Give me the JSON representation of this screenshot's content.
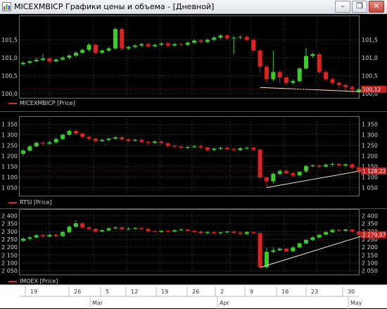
{
  "window": {
    "title": "MICEXMBICP Графики цены и объема - [Дневной]",
    "buttons": {
      "minimize": "–",
      "restore": "❐",
      "close": "✕"
    }
  },
  "colors": {
    "up": "#3ccd2d",
    "down": "#e32020",
    "grid": "#4a4a4a",
    "trend": "#f0e6c8",
    "price_label": "#c81e1e",
    "legend_line": "#d03030"
  },
  "panels": [
    {
      "id": "micex",
      "legend": "MICEXMBICP [Price]",
      "y_ticks": [
        "101,5",
        "101,0",
        "100,5",
        "100,0"
      ],
      "last_price": "100,12"
    },
    {
      "id": "rtsi",
      "legend": "RTSI [Price]",
      "y_ticks": [
        "1 350",
        "1 300",
        "1 250",
        "1 200",
        "1 150",
        "1 100",
        "1 050"
      ],
      "last_price": "1 128,22"
    },
    {
      "id": "imoex",
      "legend": "IMOEX [Price]",
      "y_ticks": [
        "2 400",
        "2 350",
        "2 300",
        "2 250",
        "2 200",
        "2 150",
        "2 100",
        "2 050"
      ],
      "last_price": "2 279,07"
    }
  ],
  "x_axis": {
    "days": [
      "19",
      "26",
      "5",
      "12",
      "19",
      "26",
      "2",
      "9",
      "16",
      "23",
      "30"
    ],
    "months": [
      "Mar",
      "Apr",
      "May"
    ]
  },
  "chart_data": [
    {
      "type": "candlestick",
      "series": "MICEXMBICP [Price]",
      "ylim": [
        99.9,
        102.1
      ],
      "last": 100.12,
      "candles": [
        [
          100.82,
          100.86,
          100.78,
          100.9
        ],
        [
          100.86,
          100.9,
          100.83,
          100.93
        ],
        [
          100.9,
          100.94,
          100.87,
          101.0
        ],
        [
          100.94,
          100.98,
          100.9,
          101.1
        ],
        [
          100.98,
          100.9,
          100.86,
          101.02
        ],
        [
          100.9,
          100.95,
          100.87,
          100.98
        ],
        [
          100.95,
          101.0,
          100.92,
          101.05
        ],
        [
          101.0,
          101.06,
          100.96,
          101.09
        ],
        [
          101.06,
          101.14,
          101.02,
          101.18
        ],
        [
          101.14,
          101.22,
          101.1,
          101.26
        ],
        [
          101.22,
          101.36,
          101.18,
          101.4
        ],
        [
          101.36,
          101.14,
          101.1,
          101.4
        ],
        [
          101.14,
          101.2,
          101.1,
          101.24
        ],
        [
          101.2,
          101.26,
          101.16,
          101.3
        ],
        [
          101.26,
          101.8,
          101.22,
          101.84
        ],
        [
          101.8,
          101.26,
          101.2,
          101.84
        ],
        [
          101.26,
          101.3,
          101.22,
          101.34
        ],
        [
          101.3,
          101.34,
          101.26,
          101.38
        ],
        [
          101.34,
          101.38,
          101.3,
          101.42
        ],
        [
          101.38,
          101.32,
          101.28,
          101.42
        ],
        [
          101.32,
          101.36,
          101.28,
          101.4
        ],
        [
          101.36,
          101.4,
          101.32,
          101.44
        ],
        [
          101.4,
          101.34,
          101.3,
          101.44
        ],
        [
          101.34,
          101.38,
          101.3,
          101.42
        ],
        [
          101.38,
          101.36,
          101.32,
          101.42
        ],
        [
          101.36,
          101.42,
          101.32,
          101.46
        ],
        [
          101.42,
          101.48,
          101.38,
          101.52
        ],
        [
          101.48,
          101.44,
          101.4,
          101.52
        ],
        [
          101.44,
          101.5,
          101.4,
          101.54
        ],
        [
          101.5,
          101.56,
          101.46,
          101.6
        ],
        [
          101.56,
          101.62,
          101.52,
          101.66
        ],
        [
          101.62,
          101.54,
          101.5,
          101.66
        ],
        [
          101.54,
          101.56,
          101.1,
          101.6
        ],
        [
          101.56,
          101.58,
          101.52,
          101.62
        ],
        [
          101.58,
          101.5,
          101.46,
          101.62
        ],
        [
          101.5,
          101.2,
          101.16,
          101.54
        ],
        [
          101.2,
          100.75,
          100.6,
          101.24
        ],
        [
          100.75,
          100.4,
          100.3,
          100.8
        ],
        [
          100.4,
          100.6,
          100.35,
          101.2
        ],
        [
          100.6,
          100.45,
          100.3,
          100.64
        ],
        [
          100.45,
          100.3,
          100.22,
          100.5
        ],
        [
          100.3,
          100.35,
          100.25,
          100.4
        ],
        [
          100.35,
          100.7,
          100.3,
          100.74
        ],
        [
          100.7,
          101.05,
          100.66,
          101.28
        ],
        [
          101.05,
          101.1,
          101.0,
          101.14
        ],
        [
          101.1,
          100.6,
          100.55,
          101.14
        ],
        [
          100.6,
          100.4,
          100.35,
          100.64
        ],
        [
          100.4,
          100.3,
          100.25,
          100.44
        ],
        [
          100.3,
          100.24,
          100.15,
          100.34
        ],
        [
          100.24,
          100.18,
          100.05,
          100.28
        ],
        [
          100.18,
          100.12,
          100.02,
          100.22
        ],
        [
          100.06,
          100.12,
          100.02,
          100.16
        ]
      ],
      "trendline": [
        [
          36,
          100.17
        ],
        [
          51,
          100.05
        ]
      ]
    },
    {
      "type": "candlestick",
      "series": "RTSI [Price]",
      "ylim": [
        1015,
        1375
      ],
      "last": 1128.22,
      "candles": [
        [
          1210,
          1225,
          1202,
          1232
        ],
        [
          1225,
          1245,
          1220,
          1250
        ],
        [
          1245,
          1262,
          1240,
          1268
        ],
        [
          1262,
          1258,
          1250,
          1270
        ],
        [
          1258,
          1264,
          1252,
          1272
        ],
        [
          1264,
          1280,
          1258,
          1286
        ],
        [
          1280,
          1300,
          1274,
          1306
        ],
        [
          1300,
          1318,
          1296,
          1324
        ],
        [
          1318,
          1306,
          1300,
          1326
        ],
        [
          1306,
          1290,
          1286,
          1310
        ],
        [
          1290,
          1282,
          1276,
          1294
        ],
        [
          1282,
          1270,
          1264,
          1288
        ],
        [
          1270,
          1276,
          1264,
          1282
        ],
        [
          1276,
          1282,
          1270,
          1286
        ],
        [
          1282,
          1288,
          1276,
          1294
        ],
        [
          1288,
          1278,
          1272,
          1294
        ],
        [
          1278,
          1272,
          1264,
          1284
        ],
        [
          1272,
          1276,
          1266,
          1282
        ],
        [
          1276,
          1266,
          1260,
          1282
        ],
        [
          1266,
          1262,
          1256,
          1272
        ],
        [
          1262,
          1268,
          1256,
          1274
        ],
        [
          1268,
          1260,
          1254,
          1274
        ],
        [
          1260,
          1248,
          1240,
          1264
        ],
        [
          1248,
          1244,
          1236,
          1254
        ],
        [
          1244,
          1238,
          1232,
          1250
        ],
        [
          1238,
          1242,
          1232,
          1248
        ],
        [
          1242,
          1246,
          1236,
          1252
        ],
        [
          1246,
          1240,
          1232,
          1252
        ],
        [
          1240,
          1228,
          1222,
          1246
        ],
        [
          1228,
          1234,
          1222,
          1240
        ],
        [
          1234,
          1238,
          1228,
          1244
        ],
        [
          1238,
          1232,
          1226,
          1244
        ],
        [
          1232,
          1228,
          1222,
          1238
        ],
        [
          1228,
          1236,
          1224,
          1242
        ],
        [
          1236,
          1238,
          1230,
          1244
        ],
        [
          1238,
          1230,
          1224,
          1244
        ],
        [
          1230,
          1098,
          1090,
          1234
        ],
        [
          1098,
          1080,
          1050,
          1102
        ],
        [
          1080,
          1115,
          1070,
          1122
        ],
        [
          1115,
          1130,
          1108,
          1136
        ],
        [
          1130,
          1118,
          1112,
          1136
        ],
        [
          1118,
          1108,
          1100,
          1124
        ],
        [
          1108,
          1125,
          1102,
          1130
        ],
        [
          1125,
          1152,
          1120,
          1158
        ],
        [
          1152,
          1155,
          1146,
          1160
        ],
        [
          1155,
          1150,
          1144,
          1160
        ],
        [
          1150,
          1158,
          1144,
          1164
        ],
        [
          1158,
          1162,
          1152,
          1168
        ],
        [
          1162,
          1155,
          1150,
          1168
        ],
        [
          1155,
          1160,
          1148,
          1166
        ],
        [
          1160,
          1145,
          1138,
          1164
        ],
        [
          1145,
          1128,
          1120,
          1150
        ]
      ],
      "trendline": [
        [
          37,
          1050
        ],
        [
          51,
          1130
        ]
      ]
    },
    {
      "type": "candlestick",
      "series": "IMOEX [Price]",
      "ylim": [
        2030,
        2425
      ],
      "last": 2279.07,
      "candles": [
        [
          2240,
          2254,
          2232,
          2262
        ],
        [
          2254,
          2262,
          2246,
          2270
        ],
        [
          2262,
          2276,
          2256,
          2284
        ],
        [
          2276,
          2268,
          2260,
          2286
        ],
        [
          2268,
          2280,
          2262,
          2288
        ],
        [
          2280,
          2270,
          2262,
          2288
        ],
        [
          2270,
          2296,
          2264,
          2304
        ],
        [
          2296,
          2330,
          2290,
          2338
        ],
        [
          2330,
          2352,
          2324,
          2372
        ],
        [
          2352,
          2326,
          2320,
          2360
        ],
        [
          2326,
          2316,
          2310,
          2334
        ],
        [
          2316,
          2300,
          2294,
          2322
        ],
        [
          2300,
          2308,
          2294,
          2314
        ],
        [
          2308,
          2320,
          2302,
          2326
        ],
        [
          2320,
          2326,
          2314,
          2332
        ],
        [
          2326,
          2314,
          2308,
          2332
        ],
        [
          2314,
          2318,
          2308,
          2326
        ],
        [
          2318,
          2322,
          2312,
          2328
        ],
        [
          2322,
          2316,
          2310,
          2328
        ],
        [
          2316,
          2302,
          2296,
          2322
        ],
        [
          2302,
          2298,
          2292,
          2308
        ],
        [
          2298,
          2304,
          2292,
          2310
        ],
        [
          2304,
          2300,
          2294,
          2310
        ],
        [
          2300,
          2308,
          2294,
          2314
        ],
        [
          2308,
          2312,
          2302,
          2318
        ],
        [
          2312,
          2304,
          2298,
          2318
        ],
        [
          2304,
          2298,
          2292,
          2310
        ],
        [
          2298,
          2290,
          2284,
          2304
        ],
        [
          2290,
          2296,
          2284,
          2302
        ],
        [
          2296,
          2288,
          2282,
          2302
        ],
        [
          2288,
          2294,
          2282,
          2300
        ],
        [
          2294,
          2300,
          2288,
          2306
        ],
        [
          2300,
          2292,
          2286,
          2306
        ],
        [
          2292,
          2284,
          2278,
          2298
        ],
        [
          2284,
          2296,
          2278,
          2302
        ],
        [
          2296,
          2290,
          2284,
          2302
        ],
        [
          2290,
          2072,
          2066,
          2296
        ],
        [
          2072,
          2170,
          2060,
          2196
        ],
        [
          2170,
          2180,
          2160,
          2200
        ],
        [
          2180,
          2190,
          2174,
          2198
        ],
        [
          2190,
          2174,
          2168,
          2196
        ],
        [
          2174,
          2198,
          2168,
          2206
        ],
        [
          2198,
          2224,
          2192,
          2230
        ],
        [
          2224,
          2246,
          2218,
          2252
        ],
        [
          2246,
          2262,
          2240,
          2268
        ],
        [
          2262,
          2280,
          2256,
          2286
        ],
        [
          2280,
          2296,
          2274,
          2302
        ],
        [
          2296,
          2310,
          2290,
          2316
        ],
        [
          2310,
          2304,
          2298,
          2316
        ],
        [
          2304,
          2312,
          2298,
          2318
        ],
        [
          2312,
          2300,
          2294,
          2316
        ],
        [
          2300,
          2279,
          2270,
          2304
        ]
      ],
      "trendline": [
        [
          36,
          2070
        ],
        [
          51,
          2270
        ]
      ]
    }
  ]
}
